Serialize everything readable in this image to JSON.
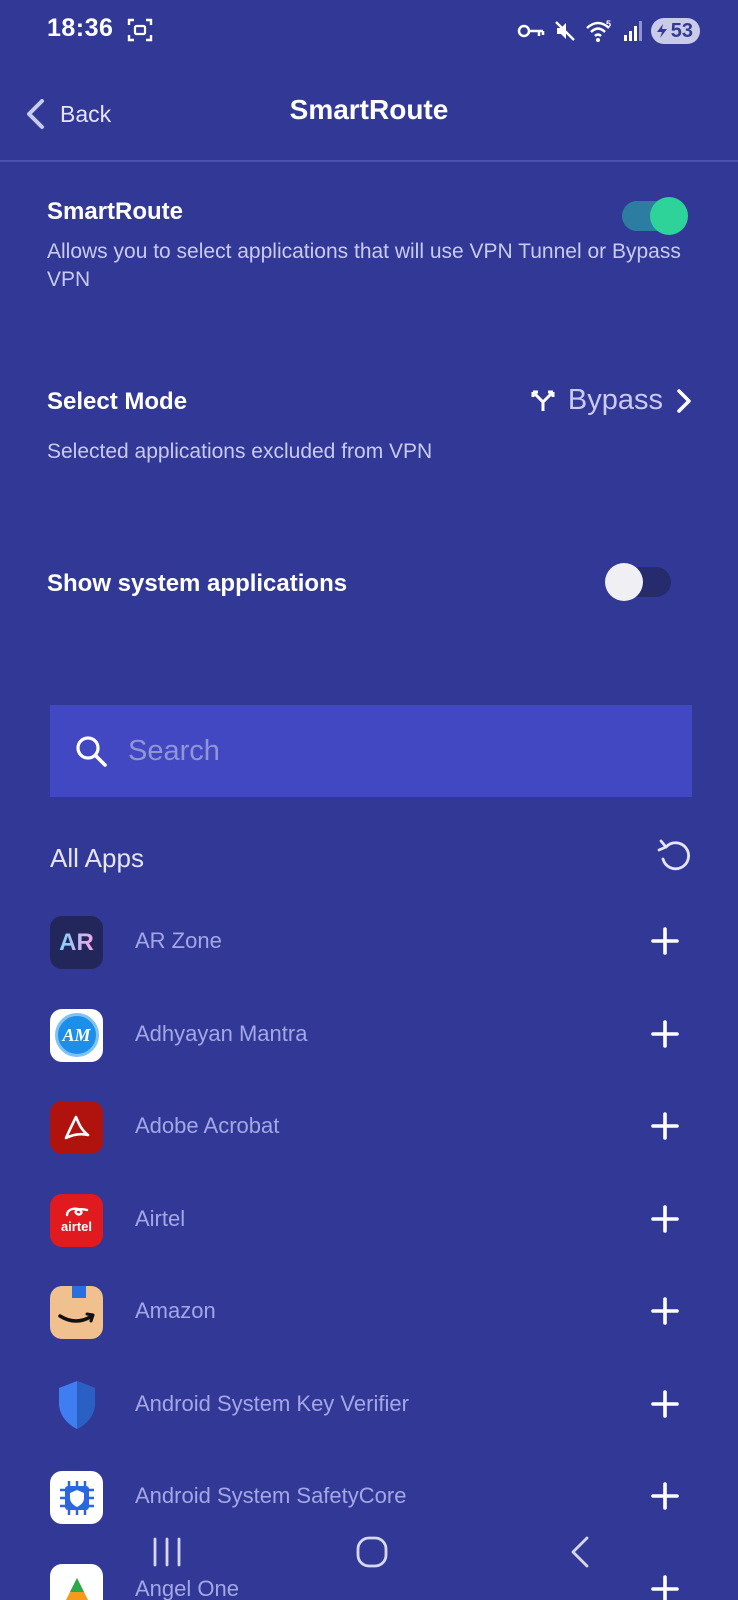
{
  "status_bar": {
    "time": "18:36",
    "battery": "53",
    "signal_label": "5"
  },
  "app_bar": {
    "back_label": "Back",
    "title": "SmartRoute"
  },
  "smartroute": {
    "title": "SmartRoute",
    "description": "Allows you to select applications that will use VPN Tunnel or Bypass VPN",
    "enabled": true
  },
  "select_mode": {
    "title": "Select Mode",
    "description": "Selected applications excluded from VPN",
    "value": "Bypass"
  },
  "system_apps": {
    "title": "Show system applications",
    "enabled": false
  },
  "search": {
    "placeholder": "Search"
  },
  "app_list": {
    "title": "All Apps",
    "items": [
      {
        "name": "AR Zone",
        "icon": "ar-zone-icon"
      },
      {
        "name": "Adhyayan Mantra",
        "icon": "adhyayan-mantra-icon"
      },
      {
        "name": "Adobe Acrobat",
        "icon": "adobe-acrobat-icon"
      },
      {
        "name": "Airtel",
        "icon": "airtel-icon"
      },
      {
        "name": "Amazon",
        "icon": "amazon-icon"
      },
      {
        "name": "Android System Key Verifier",
        "icon": "shield-icon"
      },
      {
        "name": "Android System SafetyCore",
        "icon": "safetycore-icon"
      },
      {
        "name": "Angel One",
        "icon": "angel-one-icon"
      }
    ]
  },
  "icon_text": {
    "ar": "AR",
    "am": "AM",
    "airtel": "airtel"
  },
  "colors": {
    "background": "#323896",
    "search_bg": "#4248c2",
    "toggle_on": "#2ed39a",
    "muted_text": "#a3a7e6"
  }
}
